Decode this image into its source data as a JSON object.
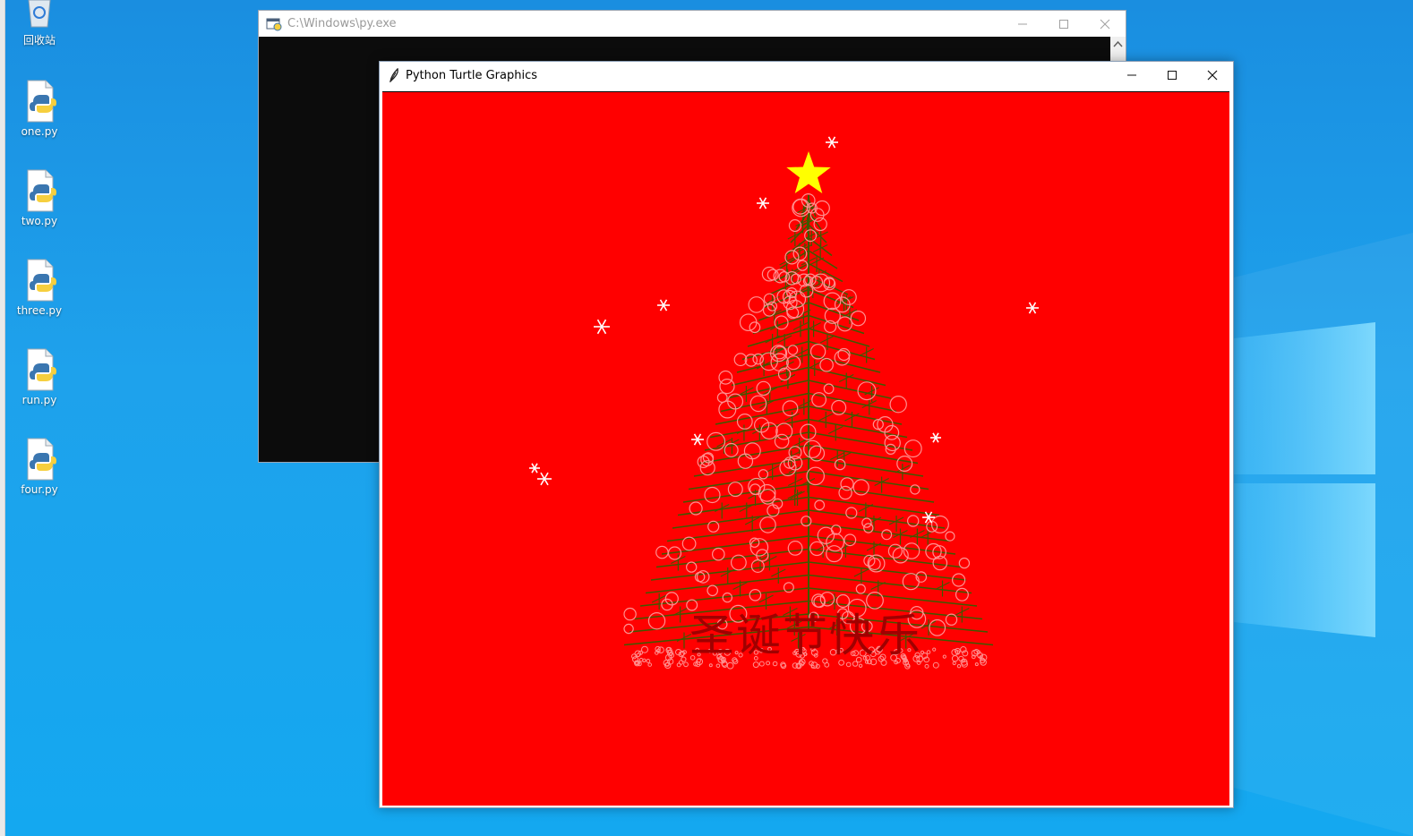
{
  "desktop": {
    "icons": [
      {
        "label": "回收站",
        "icon": "recycle-bin-icon"
      },
      {
        "label": "one.py",
        "icon": "python-file-icon"
      },
      {
        "label": "two.py",
        "icon": "python-file-icon"
      },
      {
        "label": "three.py",
        "icon": "python-file-icon"
      },
      {
        "label": "run.py",
        "icon": "python-file-icon"
      },
      {
        "label": "four.py",
        "icon": "python-file-icon"
      }
    ]
  },
  "console_window": {
    "title": "C:\\Windows\\py.exe",
    "icon": "console-app-icon",
    "background": "#0c0c0c"
  },
  "turtle_window": {
    "title": "Python Turtle Graphics",
    "icon": "feather-icon",
    "canvas_background": "#ff0000",
    "greeting": "圣诞节快乐",
    "colors": {
      "star": "#ffff00",
      "branches": "#3d5a00",
      "ornaments": "#ff9090",
      "snowflakes": "#ffffff",
      "greeting": "#a00000"
    }
  },
  "window_controls": {
    "minimize_icon": "minimize-icon",
    "maximize_icon": "maximize-icon",
    "close_icon": "close-icon"
  }
}
